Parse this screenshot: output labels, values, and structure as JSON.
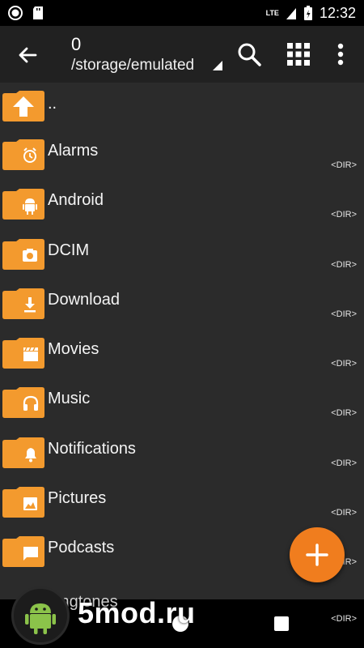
{
  "status_bar": {
    "network": "LTE",
    "time": "12:32"
  },
  "app_bar": {
    "count": "0",
    "path": "/storage/emulated",
    "icons": [
      "back-arrow-icon",
      "search-icon",
      "grid-view-icon",
      "more-vert-icon"
    ]
  },
  "list": {
    "items": [
      {
        "name": "..",
        "tag": "",
        "icon": "folder-up-icon"
      },
      {
        "name": "Alarms",
        "tag": "<DIR>",
        "icon": "alarm-icon"
      },
      {
        "name": "Android",
        "tag": "<DIR>",
        "icon": "android-icon"
      },
      {
        "name": "DCIM",
        "tag": "<DIR>",
        "icon": "camera-icon"
      },
      {
        "name": "Download",
        "tag": "<DIR>",
        "icon": "download-icon"
      },
      {
        "name": "Movies",
        "tag": "<DIR>",
        "icon": "clapperboard-icon"
      },
      {
        "name": "Music",
        "tag": "<DIR>",
        "icon": "headphones-icon"
      },
      {
        "name": "Notifications",
        "tag": "<DIR>",
        "icon": "bell-icon"
      },
      {
        "name": "Pictures",
        "tag": "<DIR>",
        "icon": "image-icon"
      },
      {
        "name": "Podcasts",
        "tag": "<DIR>",
        "icon": "chat-icon"
      },
      {
        "name": "Ringtones",
        "tag": "<DIR>",
        "icon": "folder-icon"
      }
    ],
    "ringtones_visible": "ingtones"
  },
  "fab": {
    "icon": "plus-icon"
  },
  "watermark": {
    "text": "5mod.ru"
  },
  "colors": {
    "accent": "#f07d1e",
    "folder": "#f39a2e",
    "background": "#2b2b2b",
    "appbar": "#212121"
  }
}
